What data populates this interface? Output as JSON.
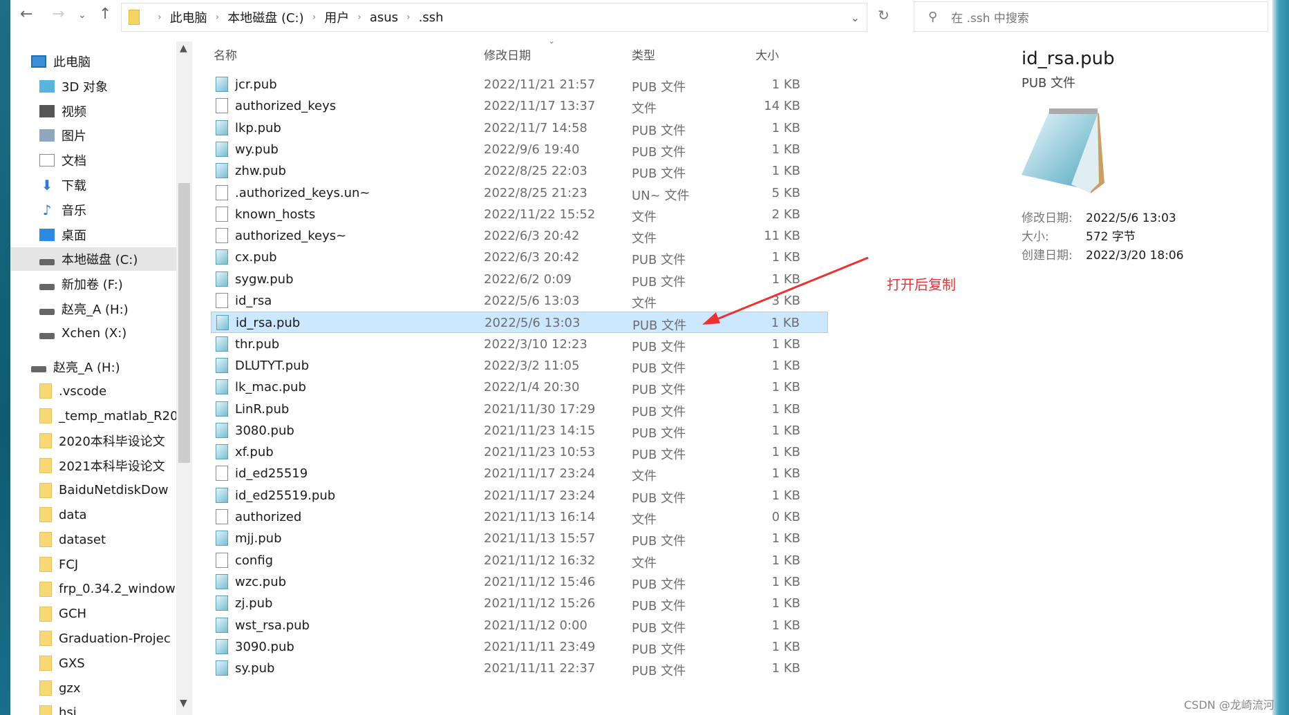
{
  "breadcrumb": [
    "此电脑",
    "本地磁盘 (C:)",
    "用户",
    "asus",
    ".ssh"
  ],
  "search": {
    "placeholder": "在 .ssh 中搜索"
  },
  "nav": [
    {
      "label": "此电脑",
      "icon": "pc",
      "indent": 0
    },
    {
      "label": "3D 对象",
      "icon": "3d",
      "indent": 1
    },
    {
      "label": "视频",
      "icon": "vid",
      "indent": 1
    },
    {
      "label": "图片",
      "icon": "pic",
      "indent": 1
    },
    {
      "label": "文档",
      "icon": "doc",
      "indent": 1
    },
    {
      "label": "下载",
      "icon": "dl",
      "indent": 1
    },
    {
      "label": "音乐",
      "icon": "mus",
      "indent": 1
    },
    {
      "label": "桌面",
      "icon": "desk",
      "indent": 1
    },
    {
      "label": "本地磁盘 (C:)",
      "icon": "drive",
      "indent": 1,
      "selected": true
    },
    {
      "label": "新加卷 (F:)",
      "icon": "drive",
      "indent": 1
    },
    {
      "label": "赵亮_A (H:)",
      "icon": "drive",
      "indent": 1
    },
    {
      "label": "Xchen (X:)",
      "icon": "drive",
      "indent": 1
    },
    {
      "label": "赵亮_A (H:)",
      "icon": "drive",
      "indent": 0,
      "gap": true
    },
    {
      "label": ".vscode",
      "icon": "folder",
      "indent": 1
    },
    {
      "label": "_temp_matlab_R20",
      "icon": "folder",
      "indent": 1
    },
    {
      "label": "2020本科毕设论文",
      "icon": "folder",
      "indent": 1
    },
    {
      "label": "2021本科毕设论文",
      "icon": "folder",
      "indent": 1
    },
    {
      "label": "BaiduNetdiskDow",
      "icon": "folder",
      "indent": 1
    },
    {
      "label": "data",
      "icon": "folder",
      "indent": 1
    },
    {
      "label": "dataset",
      "icon": "folder",
      "indent": 1
    },
    {
      "label": "FCJ",
      "icon": "folder",
      "indent": 1
    },
    {
      "label": "frp_0.34.2_window",
      "icon": "folder",
      "indent": 1
    },
    {
      "label": "GCH",
      "icon": "folder",
      "indent": 1
    },
    {
      "label": "Graduation-Projec",
      "icon": "folder",
      "indent": 1
    },
    {
      "label": "GXS",
      "icon": "folder",
      "indent": 1
    },
    {
      "label": "gzx",
      "icon": "folder",
      "indent": 1
    },
    {
      "label": "hsi",
      "icon": "folder",
      "indent": 1
    }
  ],
  "columns": {
    "name": "名称",
    "date": "修改日期",
    "type": "类型",
    "size": "大小"
  },
  "files": [
    [
      "jcr.pub",
      "2022/11/21 21:57",
      "PUB 文件",
      "1 KB"
    ],
    [
      "authorized_keys",
      "2022/11/17 13:37",
      "文件",
      "14 KB"
    ],
    [
      "lkp.pub",
      "2022/11/7 14:58",
      "PUB 文件",
      "1 KB"
    ],
    [
      "wy.pub",
      "2022/9/6 19:40",
      "PUB 文件",
      "1 KB"
    ],
    [
      "zhw.pub",
      "2022/8/25 22:03",
      "PUB 文件",
      "1 KB"
    ],
    [
      ".authorized_keys.un~",
      "2022/8/25 21:23",
      "UN~ 文件",
      "5 KB"
    ],
    [
      "known_hosts",
      "2022/11/22 15:52",
      "文件",
      "2 KB"
    ],
    [
      "authorized_keys~",
      "2022/6/3 20:42",
      "文件",
      "11 KB"
    ],
    [
      "cx.pub",
      "2022/6/3 20:42",
      "PUB 文件",
      "1 KB"
    ],
    [
      "sygw.pub",
      "2022/6/2 0:09",
      "PUB 文件",
      "1 KB"
    ],
    [
      "id_rsa",
      "2022/5/6 13:03",
      "文件",
      "3 KB"
    ],
    [
      "id_rsa.pub",
      "2022/5/6 13:03",
      "PUB 文件",
      "1 KB"
    ],
    [
      "thr.pub",
      "2022/3/10 12:23",
      "PUB 文件",
      "1 KB"
    ],
    [
      "DLUTYT.pub",
      "2022/3/2 11:05",
      "PUB 文件",
      "1 KB"
    ],
    [
      "lk_mac.pub",
      "2022/1/4 20:30",
      "PUB 文件",
      "1 KB"
    ],
    [
      "LinR.pub",
      "2021/11/30 17:29",
      "PUB 文件",
      "1 KB"
    ],
    [
      "3080.pub",
      "2021/11/23 14:15",
      "PUB 文件",
      "1 KB"
    ],
    [
      "xf.pub",
      "2021/11/23 10:53",
      "PUB 文件",
      "1 KB"
    ],
    [
      "id_ed25519",
      "2021/11/17 23:24",
      "文件",
      "1 KB"
    ],
    [
      "id_ed25519.pub",
      "2021/11/17 23:24",
      "PUB 文件",
      "1 KB"
    ],
    [
      "authorized",
      "2021/11/13 16:14",
      "文件",
      "0 KB"
    ],
    [
      "mjj.pub",
      "2021/11/13 15:57",
      "PUB 文件",
      "1 KB"
    ],
    [
      "config",
      "2021/11/12 16:32",
      "文件",
      "1 KB"
    ],
    [
      "wzc.pub",
      "2021/11/12 15:46",
      "PUB 文件",
      "1 KB"
    ],
    [
      "zj.pub",
      "2021/11/12 15:26",
      "PUB 文件",
      "1 KB"
    ],
    [
      "wst_rsa.pub",
      "2021/11/12 0:00",
      "PUB 文件",
      "1 KB"
    ],
    [
      "3090.pub",
      "2021/11/11 23:49",
      "PUB 文件",
      "1 KB"
    ],
    [
      "sy.pub",
      "2021/11/11 22:37",
      "PUB 文件",
      "1 KB"
    ]
  ],
  "selected_file": "id_rsa.pub",
  "preview": {
    "title": "id_rsa.pub",
    "type": "PUB 文件",
    "details": [
      [
        "修改日期:",
        "2022/5/6 13:03"
      ],
      [
        "大小:",
        "572 字节"
      ],
      [
        "创建日期:",
        "2022/3/20 18:06"
      ]
    ]
  },
  "annotation": {
    "text": "打开后复制",
    "color": "#f03030"
  },
  "watermark": "CSDN @龙崎流河",
  "colors": {
    "selection": "#cce8ff",
    "folder": "#f8d775"
  }
}
